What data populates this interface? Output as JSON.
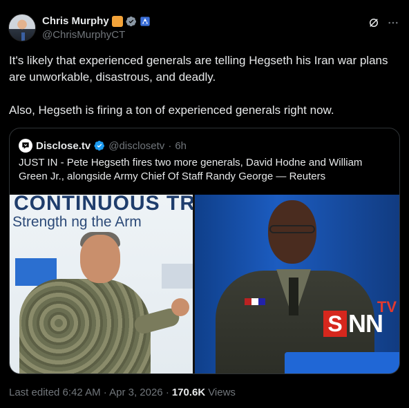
{
  "author": {
    "display_name": "Chris Murphy",
    "handle": "@ChrisMurphyCT"
  },
  "icons": {
    "verified": "verified-badge-icon",
    "grok": "grok-icon",
    "more": "more-icon"
  },
  "tweet": {
    "paragraphs": [
      "It's likely that experienced generals are telling Hegseth his Iran war plans are unworkable, disastrous, and deadly.",
      "Also, Hegseth is firing a ton of experienced generals right now."
    ]
  },
  "quote": {
    "display_name": "Disclose.tv",
    "handle": "@disclosetv",
    "separator": "·",
    "time": "6h",
    "text": "JUST IN - Pete Hegseth fires two more generals, David Hodne and William Green Jr., alongside Army Chief Of Staff Randy George — Reuters",
    "media": {
      "left_banner_line1": "CONTINUOUS TR",
      "left_banner_line2": "Strength ng the Arm",
      "watermark_tv": "TV",
      "watermark_s": "S",
      "watermark_nn": "NN"
    }
  },
  "meta": {
    "edited": "Last edited 6:42 AM · Apr 3, 2026 ·",
    "views_count": "170.6K",
    "views_label": "Views"
  },
  "colors": {
    "background": "#000000",
    "text": "#e7e9ea",
    "muted": "#71767b",
    "verified": "#1d9bf0",
    "border": "#2f3336"
  }
}
